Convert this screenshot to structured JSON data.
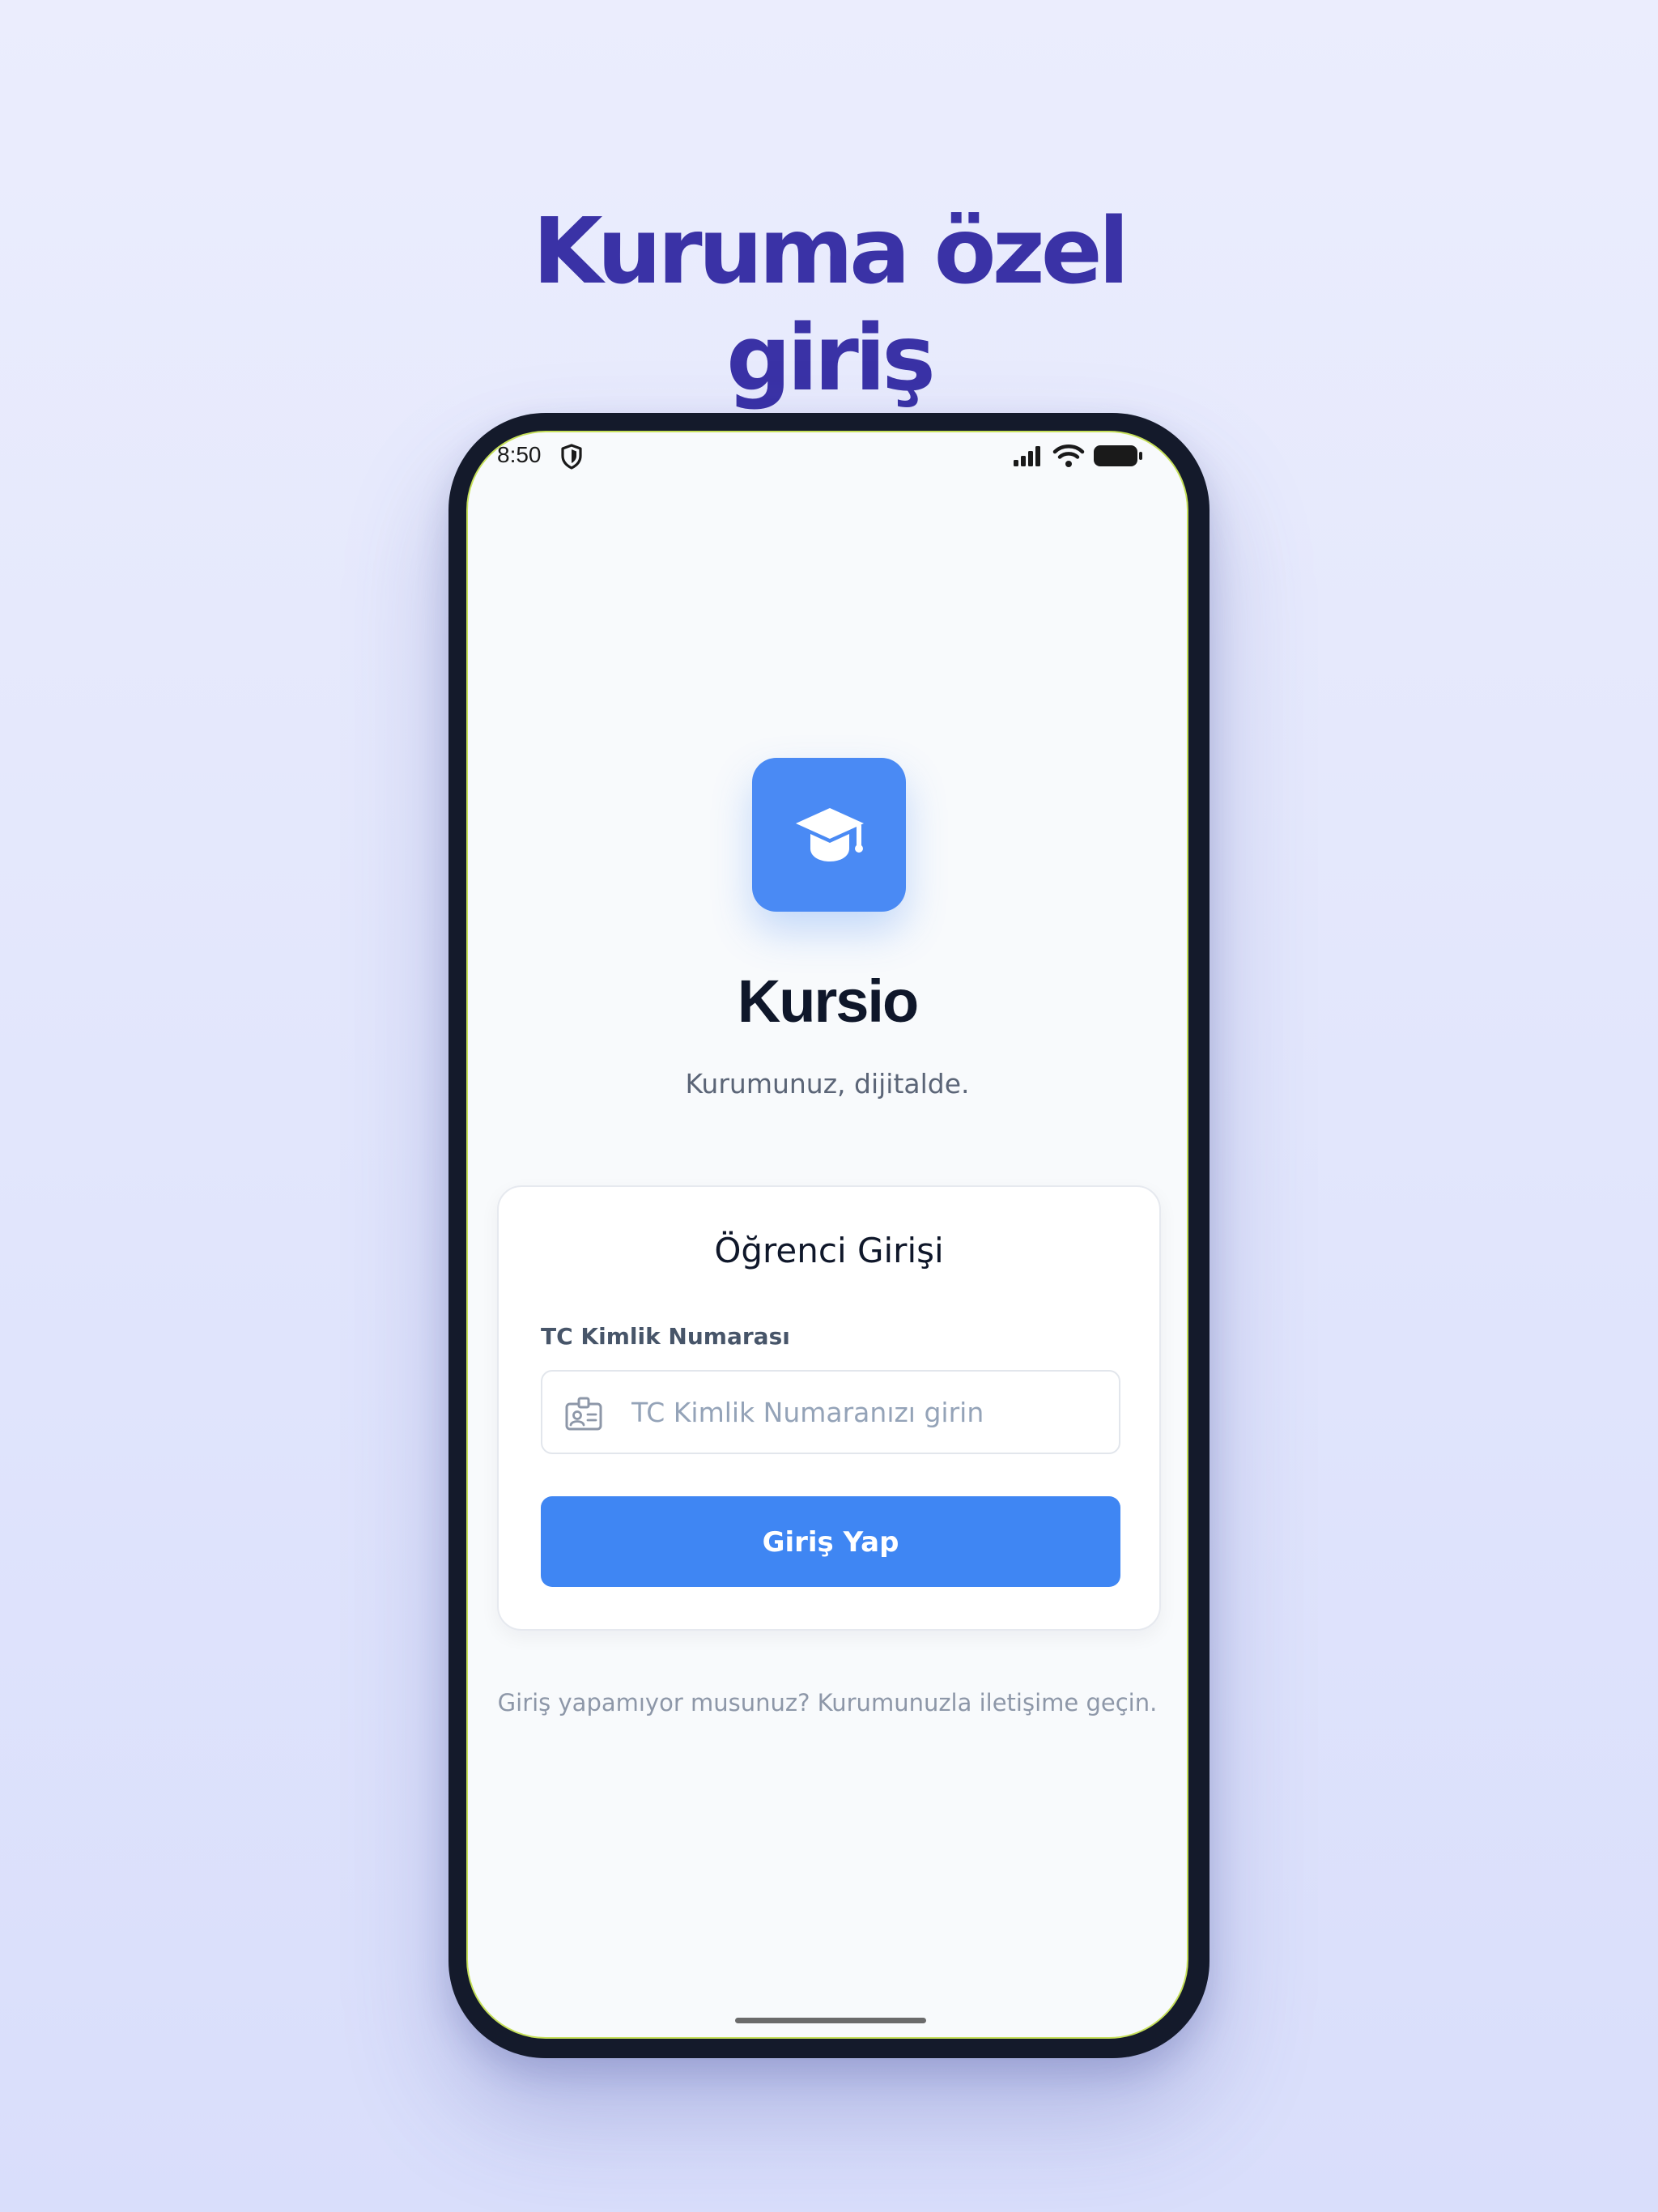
{
  "headline": {
    "line1": "Kuruma özel",
    "line2": "giriş"
  },
  "status_bar": {
    "time": "8:50",
    "icons": [
      "shield-icon",
      "signal-icon",
      "wifi-icon",
      "battery-icon"
    ]
  },
  "app": {
    "logo_icon": "graduation-cap-icon",
    "name": "Kursio",
    "tagline": "Kurumunuz, dijitalde."
  },
  "login_card": {
    "title": "Öğrenci Girişi",
    "tc_field": {
      "label": "TC Kimlik Numarası",
      "placeholder": "TC Kimlik Numaranızı girin",
      "value": "",
      "icon": "id-card-icon"
    },
    "submit_label": "Giriş Yap"
  },
  "help_text": "Giriş yapamıyor musunuz? Kurumunuzla iletişime geçin.",
  "colors": {
    "headline": "#3a32a6",
    "primary": "#3f86f3",
    "logo_bg": "#4a8af4",
    "phone_frame": "#141a2b"
  }
}
